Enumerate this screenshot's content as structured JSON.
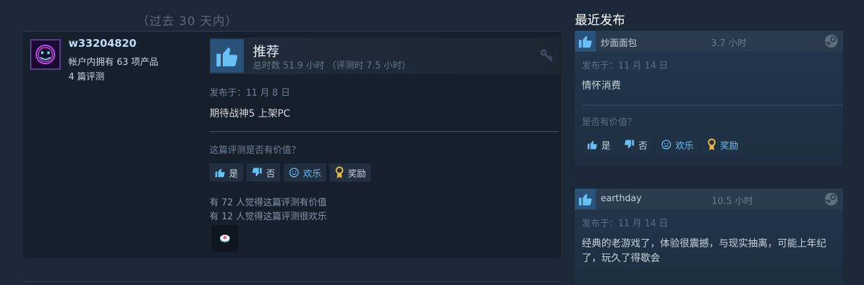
{
  "main": {
    "period": "（过去 30 天内）",
    "review": {
      "username": "w33204820",
      "owned": "帐户内拥有 63 项产品",
      "review_count": "4 篇评测",
      "recommendation": "推荐",
      "hours": "总时数 51.9 小时 （评测时 7.5 小时）",
      "posted": "发布于：11 月 8 日",
      "content": "期待战神5 上架PC",
      "helpful_question": "这篇评测是否有价值？",
      "buttons": {
        "yes": "是",
        "no": "否",
        "funny": "欢乐",
        "award": "奖励"
      },
      "found_helpful": "有 72 人觉得这篇评测有价值",
      "found_funny": "有 12 人觉得这篇评测很欢乐"
    }
  },
  "sidebar": {
    "title": "最近发布",
    "reviews": [
      {
        "username": "炒面面包",
        "hours": "3.7 小时",
        "posted": "发布于：11 月 14 日",
        "content": "情怀消费",
        "helpful_question": "是否有价值？",
        "buttons": {
          "yes": "是",
          "no": "否",
          "funny": "欢乐",
          "award": "奖励"
        }
      },
      {
        "username": "earthday",
        "hours": "10.5 小时",
        "posted": "发布于：11 月 14 日",
        "content": "经典的老游戏了，体验很震撼，与现实抽离，可能上年纪了，玩久了得歇会"
      }
    ]
  },
  "icons": {
    "thumb": "thumbs-up-icon",
    "key": "key-icon",
    "steam": "steam-icon",
    "down": "thumbs-down-icon",
    "smile": "smile-icon",
    "award": "award-icon"
  },
  "colors": {
    "accent": "#67c1f5",
    "thumb_bg": "#2b5379",
    "background": "#1b2838"
  }
}
